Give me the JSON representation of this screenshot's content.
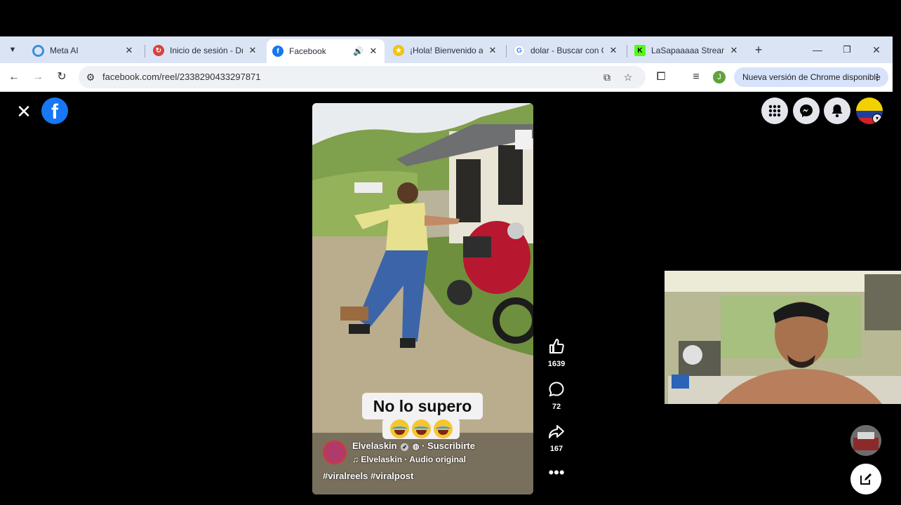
{
  "browser": {
    "tabs": [
      {
        "title": "Meta AI",
        "icon": "meta-ai-icon",
        "color": "#3b8fd6"
      },
      {
        "title": "Inicio de sesión - Dro",
        "icon": "login-icon",
        "color": "#d9413a"
      },
      {
        "title": "Facebook",
        "icon": "facebook-icon",
        "color": "#1877f2",
        "active": true
      },
      {
        "title": "¡Hola! Bienvenido a T",
        "icon": "star-icon",
        "color": "#f3c211"
      },
      {
        "title": "dolar - Buscar con Go",
        "icon": "google-icon",
        "color": "#4285f4"
      },
      {
        "title": "LaSapaaaaa Stream -",
        "icon": "kick-icon",
        "color": "#53fc18"
      }
    ],
    "url": "facebook.com/reel/2338290433297871",
    "update_label": "Nueva versión de Chrome disponible",
    "profile_initial": "J"
  },
  "reel": {
    "caption": "No lo supero",
    "author": "Elvelaskin",
    "subscribe": "· Suscribirte",
    "audio": "Elvelaskin · Audio original",
    "hashtags": "#viralreels #viralpost",
    "likes": "1639",
    "comments": "72",
    "shares": "167"
  },
  "colors": {
    "accent": "#1877f2",
    "tabbar": "#dbe4f5"
  }
}
